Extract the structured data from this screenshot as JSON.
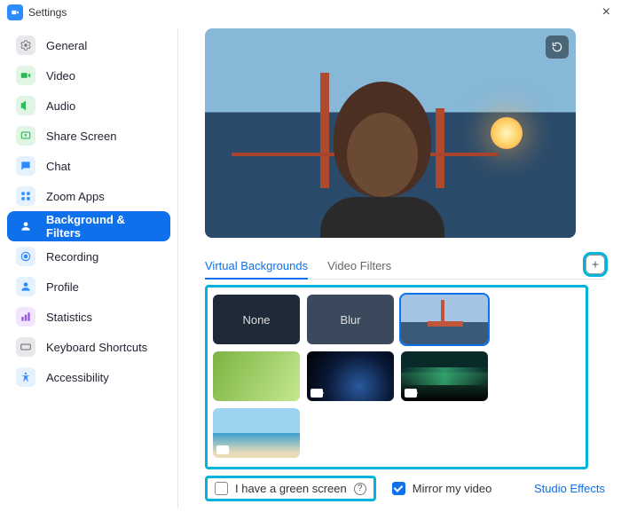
{
  "window": {
    "title": "Settings"
  },
  "sidebar": {
    "items": [
      {
        "id": "general",
        "label": "General",
        "icon": "gear",
        "bg": "#E8E8EC",
        "fg": "#777"
      },
      {
        "id": "video",
        "label": "Video",
        "icon": "video",
        "bg": "#E1F5E4",
        "fg": "#2EBB55"
      },
      {
        "id": "audio",
        "label": "Audio",
        "icon": "audio",
        "bg": "#E1F5E4",
        "fg": "#2EBB55"
      },
      {
        "id": "share",
        "label": "Share Screen",
        "icon": "share",
        "bg": "#E1F5E4",
        "fg": "#2EBB55"
      },
      {
        "id": "chat",
        "label": "Chat",
        "icon": "chat",
        "bg": "#E6F1FE",
        "fg": "#2D8CFF"
      },
      {
        "id": "apps",
        "label": "Zoom Apps",
        "icon": "apps",
        "bg": "#E6F1FE",
        "fg": "#2D8CFF"
      },
      {
        "id": "background",
        "label": "Background & Filters",
        "icon": "bg",
        "bg": "#0E71EB",
        "fg": "#fff",
        "selected": true
      },
      {
        "id": "recording",
        "label": "Recording",
        "icon": "rec",
        "bg": "#E6F1FE",
        "fg": "#2D8CFF"
      },
      {
        "id": "profile",
        "label": "Profile",
        "icon": "profile",
        "bg": "#E6F1FE",
        "fg": "#2D8CFF"
      },
      {
        "id": "stats",
        "label": "Statistics",
        "icon": "stats",
        "bg": "#F1E6FE",
        "fg": "#9B51E0"
      },
      {
        "id": "shortcuts",
        "label": "Keyboard Shortcuts",
        "icon": "kbd",
        "bg": "#E8E8EC",
        "fg": "#777"
      },
      {
        "id": "a11y",
        "label": "Accessibility",
        "icon": "a11y",
        "bg": "#E6F1FE",
        "fg": "#2D8CFF"
      }
    ]
  },
  "tabs": {
    "virtual": "Virtual Backgrounds",
    "filters": "Video Filters"
  },
  "backgrounds": {
    "none": "None",
    "blur": "Blur"
  },
  "footer": {
    "green": "I have a green screen",
    "mirror": "Mirror my video",
    "studio": "Studio Effects"
  },
  "state": {
    "green_checked": false,
    "mirror_checked": true,
    "selected_bg": "bridge",
    "active_tab": "virtual"
  }
}
